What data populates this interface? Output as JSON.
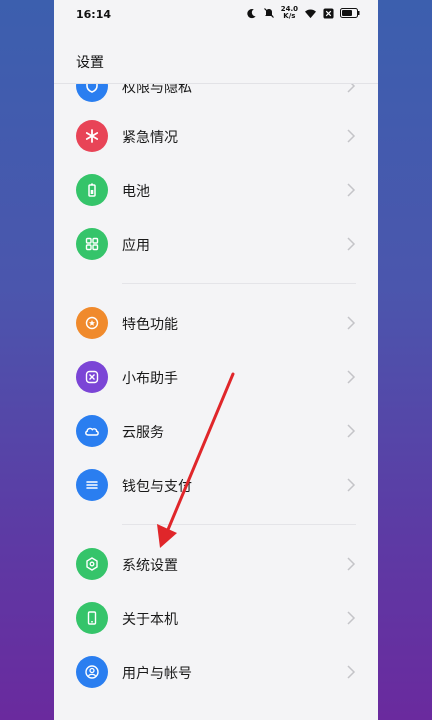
{
  "status_bar": {
    "time": "16:14",
    "net_speed_value": "24.0",
    "net_speed_unit": "K/s",
    "icons": [
      "moon-icon",
      "mute-icon",
      "wifi-icon",
      "sim-off-icon",
      "battery-icon"
    ]
  },
  "header": {
    "title": "设置"
  },
  "sections": [
    {
      "items": [
        {
          "label": "权限与隐私",
          "icon": "shield-icon",
          "color": "#2a7ef0"
        },
        {
          "label": "紧急情况",
          "icon": "asterisk-icon",
          "color": "#e84457"
        },
        {
          "label": "电池",
          "icon": "battery-icon",
          "color": "#35c46a"
        },
        {
          "label": "应用",
          "icon": "grid-icon",
          "color": "#35c46a"
        }
      ]
    },
    {
      "items": [
        {
          "label": "特色功能",
          "icon": "star-icon",
          "color": "#f08a2c"
        },
        {
          "label": "小布助手",
          "icon": "assistant-icon",
          "color": "#7b45d6"
        },
        {
          "label": "云服务",
          "icon": "cloud-icon",
          "color": "#2a7ef0"
        },
        {
          "label": "钱包与支付",
          "icon": "wallet-icon",
          "color": "#2a7ef0"
        }
      ]
    },
    {
      "items": [
        {
          "label": "系统设置",
          "icon": "hexagon-icon",
          "color": "#35c46a"
        },
        {
          "label": "关于本机",
          "icon": "phone-icon",
          "color": "#35c46a"
        },
        {
          "label": "用户与帐号",
          "icon": "user-icon",
          "color": "#2a7ef0"
        }
      ]
    }
  ],
  "annotation": {
    "arrow_color": "#e0262a"
  }
}
